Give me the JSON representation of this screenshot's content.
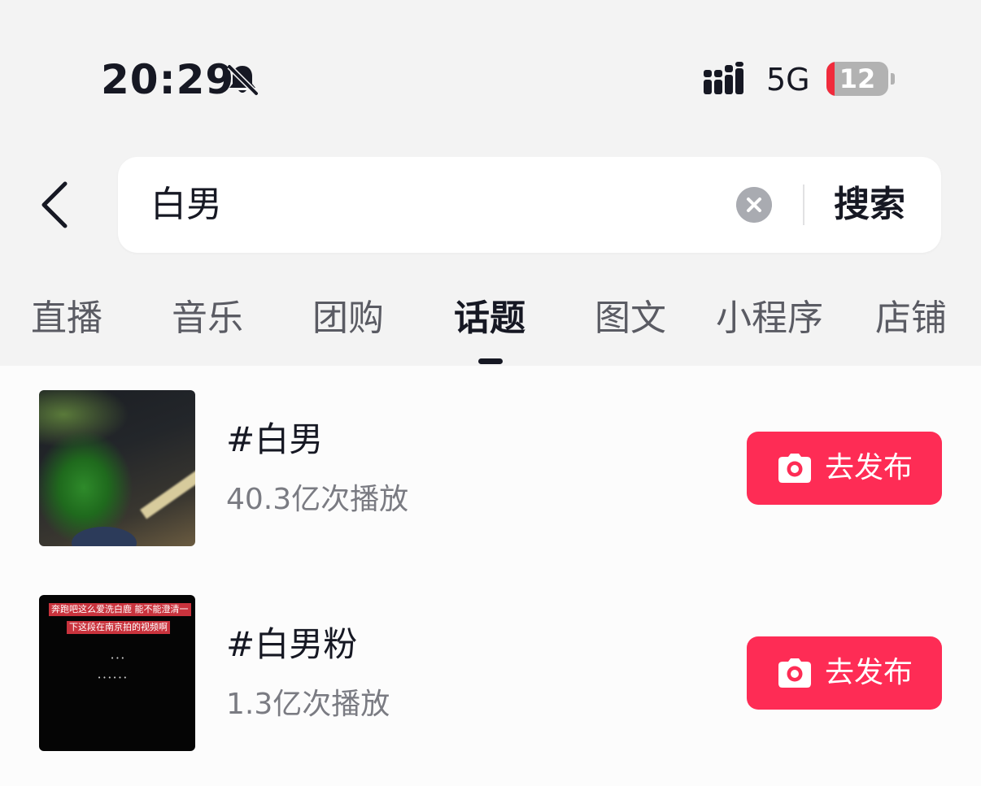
{
  "status_bar": {
    "time": "20:29",
    "network": "5G",
    "battery_percent": "12",
    "battery_level": 0.12,
    "icons": [
      "bell-muted-icon",
      "signal-icon",
      "battery-icon"
    ]
  },
  "search": {
    "query": "白男",
    "submit_label": "搜索"
  },
  "tabs": [
    {
      "label": "直播",
      "active": false
    },
    {
      "label": "音乐",
      "active": false
    },
    {
      "label": "团购",
      "active": false
    },
    {
      "label": "话题",
      "active": true
    },
    {
      "label": "图文",
      "active": false
    },
    {
      "label": "小程序",
      "active": false
    },
    {
      "label": "店铺",
      "active": false
    }
  ],
  "results": [
    {
      "title": "#白男",
      "plays": "40.3亿次播放",
      "button_label": "去发布"
    },
    {
      "title": "#白男粉",
      "plays": "1.3亿次播放",
      "button_label": "去发布",
      "thumbnail_captions": [
        "奔跑吧这么爱洗白鹿 能不能澄清一",
        "下这段在南京拍的视频啊"
      ]
    }
  ],
  "colors": {
    "accent": "#fe2c55",
    "background": "#f3f3f3",
    "text": "#161823",
    "secondary_text": "#7a7b82"
  }
}
